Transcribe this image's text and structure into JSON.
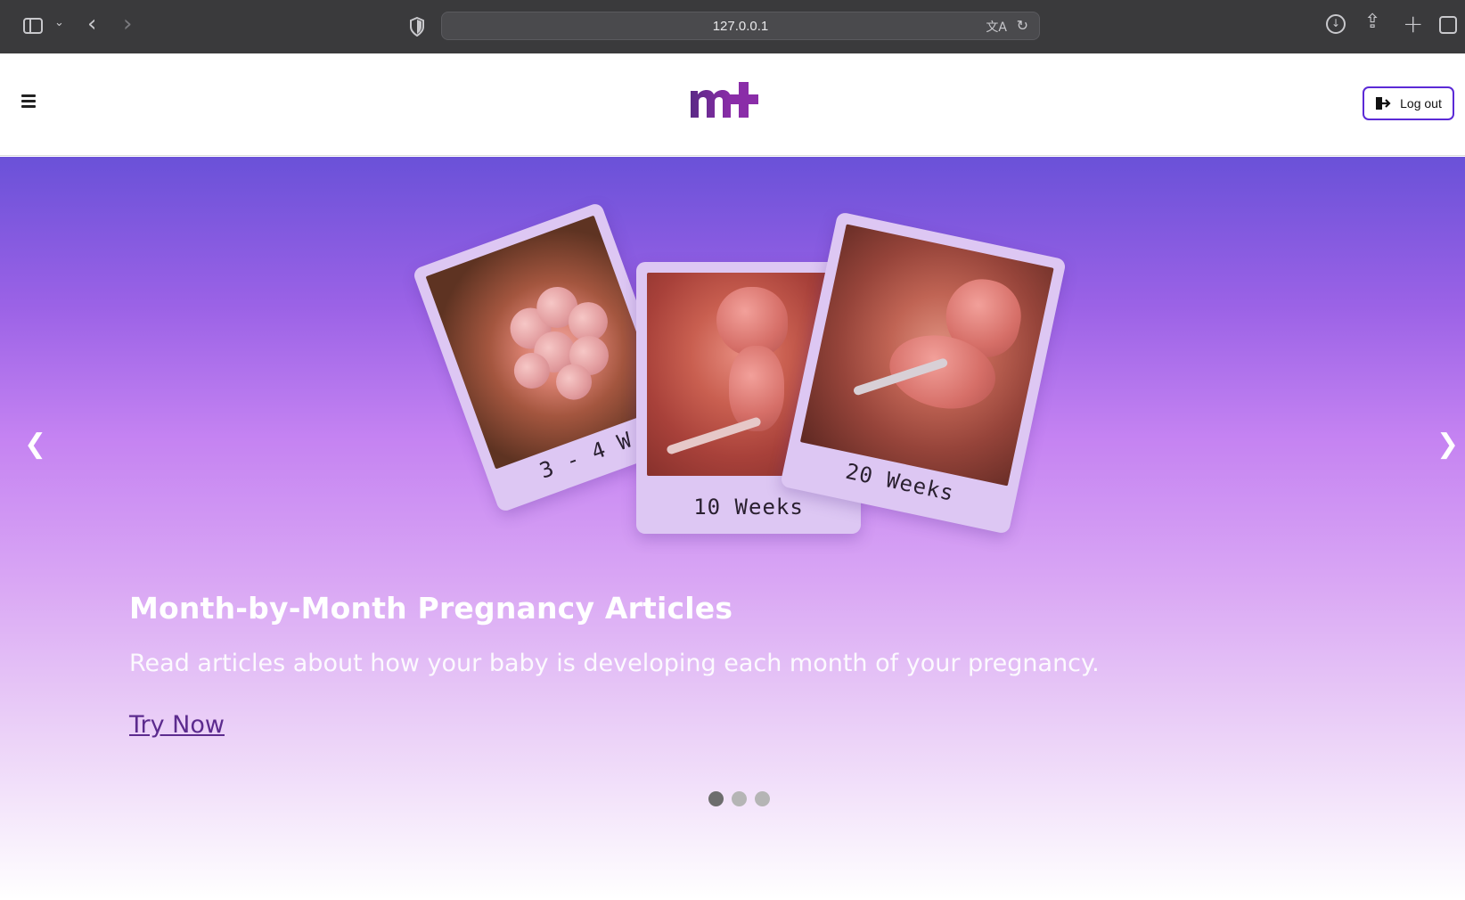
{
  "browser": {
    "url": "127.0.0.1",
    "icons": [
      "sidebar-toggle-icon",
      "chevron-down-icon",
      "back-icon",
      "forward-icon",
      "shield-icon",
      "translate-icon",
      "reload-icon",
      "download-icon",
      "share-icon",
      "new-tab-icon",
      "tabs-overview-icon"
    ]
  },
  "header": {
    "logo_text": "m+",
    "logout_label": "Log out",
    "brand_color": "#5b2ad6"
  },
  "hero": {
    "cards": [
      {
        "caption": "3 - 4 W"
      },
      {
        "caption": "10 Weeks"
      },
      {
        "caption": "20 Weeks"
      }
    ],
    "title": "Month-by-Month Pregnancy Articles",
    "subtitle": "Read articles about how your baby is developing each month of your pregnancy.",
    "cta_label": "Try Now",
    "prev_arrow": "❮",
    "next_arrow": "❯",
    "slide_count": 3,
    "active_slide": 1
  }
}
